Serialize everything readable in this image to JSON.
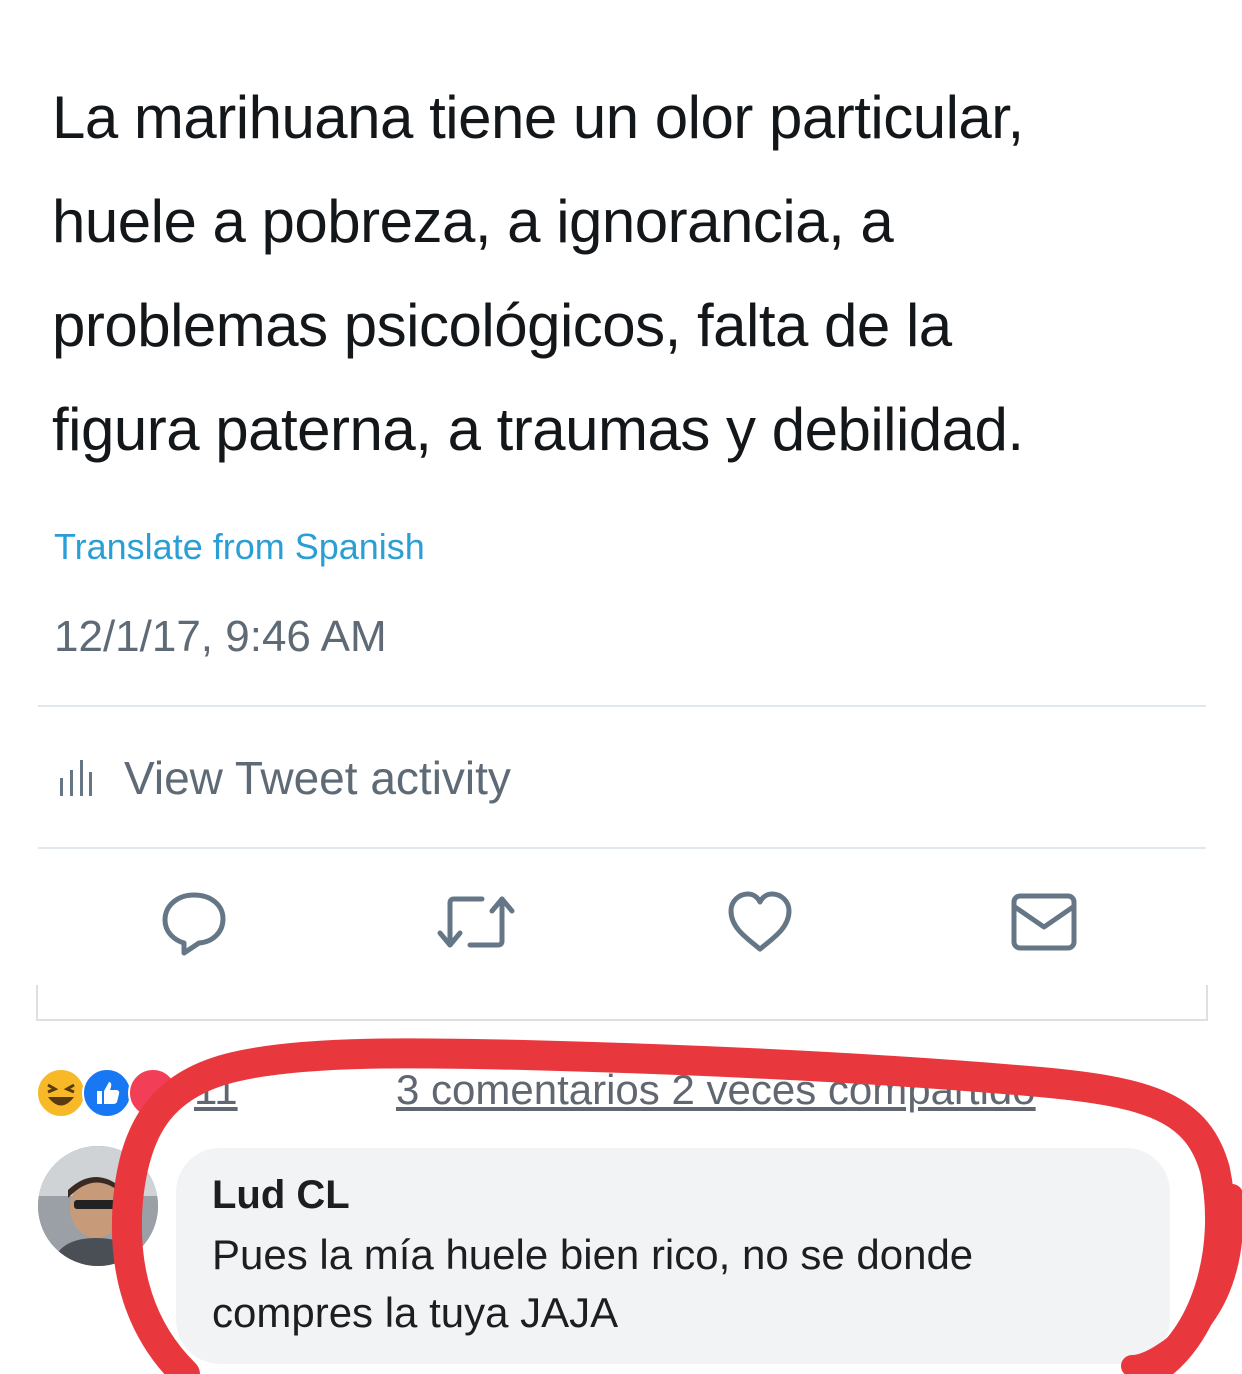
{
  "tweet": {
    "text_lines": [
      "La marihuana tiene un olor particular,",
      "huele a pobreza, a ignorancia, a",
      "problemas psicológicos, falta de la",
      "figura paterna, a traumas y debilidad."
    ],
    "translate_label": "Translate from Spanish",
    "timestamp": "12/1/17, 9:46 AM",
    "activity_label": "View Tweet activity",
    "actions": [
      "reply-icon",
      "retweet-icon",
      "like-icon",
      "message-icon"
    ],
    "accent_color": "#2a9fd6"
  },
  "facebook": {
    "reaction_icons": [
      "haha-icon",
      "like-icon",
      "love-icon"
    ],
    "reaction_count": "11",
    "meta": "3 comentarios  2 veces compartido",
    "comment": {
      "author": "Lud CL",
      "text_lines": [
        "Pues la mía huele bien rico, no se donde",
        "compres la tuya JAJA"
      ]
    },
    "highlight_color": "#e8383d"
  }
}
